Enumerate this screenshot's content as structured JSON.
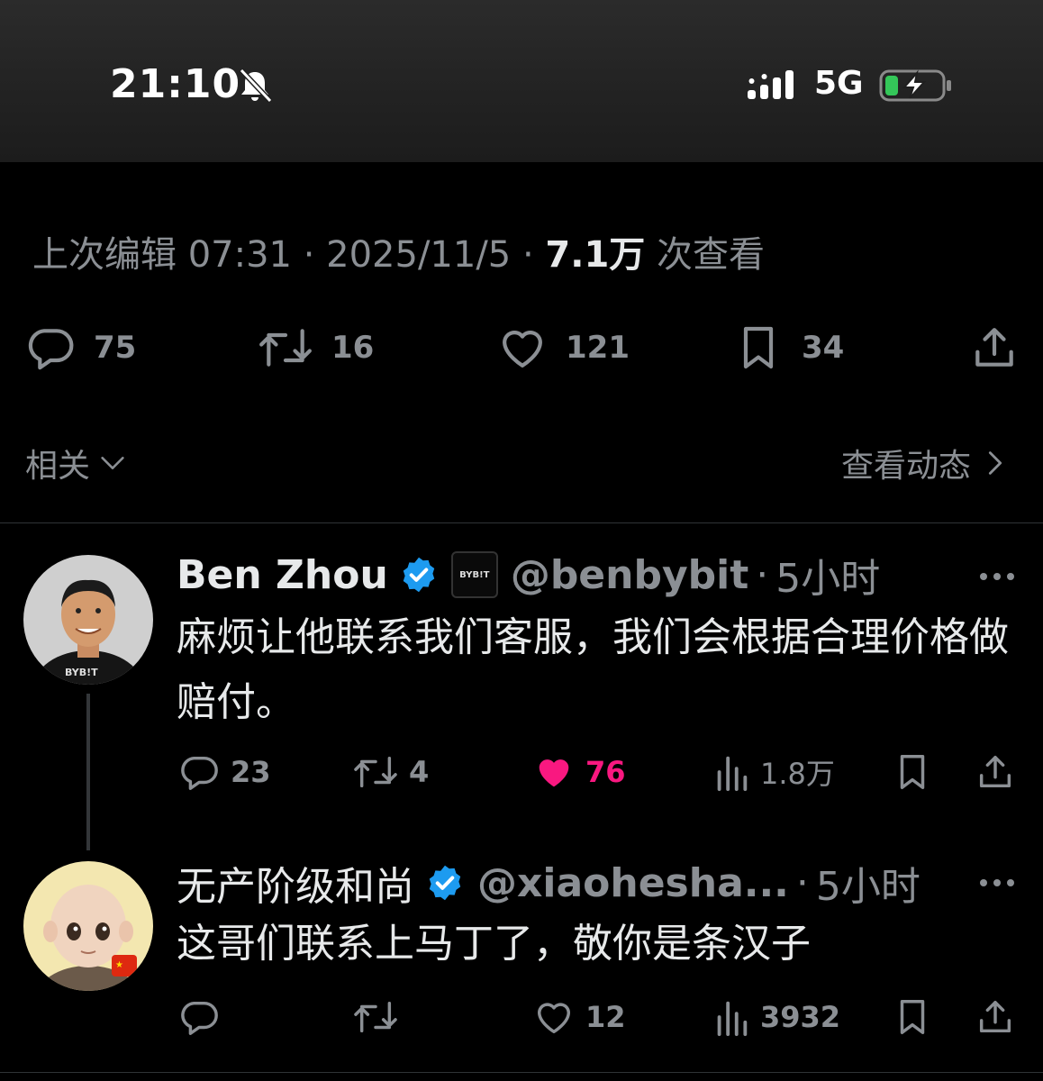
{
  "status_bar": {
    "time": "21:10",
    "network": "5G",
    "icons": [
      "bell-muted-icon",
      "signal-icon",
      "battery-charging-icon"
    ]
  },
  "tweet": {
    "meta": {
      "edited_label": "上次编辑 07:31",
      "sep": "·",
      "date": "2025/11/5",
      "views_count": "7.1万",
      "views_label": "次查看"
    },
    "actions": {
      "replies": "75",
      "retweets": "16",
      "likes": "121",
      "bookmarks": "34"
    }
  },
  "filter": {
    "related_label": "相关",
    "activity_label": "查看动态"
  },
  "replies": [
    {
      "name": "Ben Zhou",
      "affiliate_badge": "BYB!T",
      "handle": "@benbybit",
      "time": "5小时",
      "text": "麻烦让他联系我们客服，我们会根据合理价格做赔付。",
      "replies": "23",
      "retweets": "4",
      "likes": "76",
      "views": "1.8万",
      "liked": true,
      "avatar_shirt_text": "BYB!T"
    },
    {
      "name": "无产阶级和尚",
      "handle": "@xiaohesha...",
      "time": "5小时",
      "text": "这哥们联系上马丁了，敬你是条汉子",
      "replies": "",
      "retweets": "",
      "likes": "12",
      "views": "3932",
      "liked": false
    }
  ],
  "colors": {
    "background": "#000000",
    "muted": "#8b8f94",
    "text": "#e7e9ea",
    "verified": "#1d9bf0",
    "like": "#f91880"
  }
}
